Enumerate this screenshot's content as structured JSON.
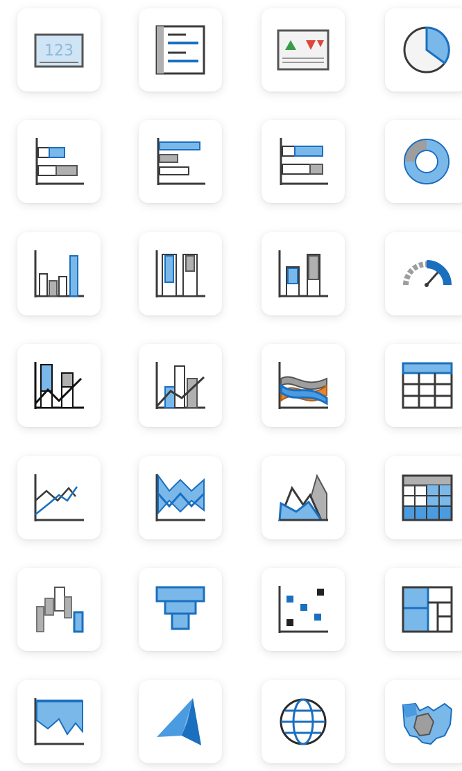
{
  "palette": {
    "blue": "#1a6fbf",
    "light_blue": "#7ab8ea",
    "gray": "#9e9e9e",
    "dark": "#3a3a3a",
    "orange": "#e8842c",
    "green": "#3a9b46",
    "red": "#e0443a"
  },
  "visuals": [
    {
      "icon": "card-icon"
    },
    {
      "icon": "multi-row-card-icon"
    },
    {
      "icon": "kpi-icon"
    },
    {
      "icon": "pie-chart-icon"
    },
    {
      "icon": "stacked-bar-chart-icon"
    },
    {
      "icon": "clustered-bar-chart-icon"
    },
    {
      "icon": "100-percent-stacked-bar-chart-icon"
    },
    {
      "icon": "donut-chart-icon"
    },
    {
      "icon": "stacked-column-chart-icon"
    },
    {
      "icon": "clustered-column-chart-icon"
    },
    {
      "icon": "100-percent-stacked-column-chart-icon"
    },
    {
      "icon": "gauge-icon"
    },
    {
      "icon": "line-and-stacked-column-chart-icon"
    },
    {
      "icon": "line-and-clustered-column-chart-icon"
    },
    {
      "icon": "ribbon-chart-icon"
    },
    {
      "icon": "table-icon"
    },
    {
      "icon": "line-chart-icon"
    },
    {
      "icon": "stacked-area-chart-icon"
    },
    {
      "icon": "area-chart-icon"
    },
    {
      "icon": "matrix-icon"
    },
    {
      "icon": "waterfall-chart-icon"
    },
    {
      "icon": "funnel-chart-icon"
    },
    {
      "icon": "scatter-chart-icon"
    },
    {
      "icon": "treemap-icon"
    },
    {
      "icon": "filled-area-chart-icon"
    },
    {
      "icon": "azure-map-icon"
    },
    {
      "icon": "globe-map-icon"
    },
    {
      "icon": "shape-map-icon"
    }
  ]
}
